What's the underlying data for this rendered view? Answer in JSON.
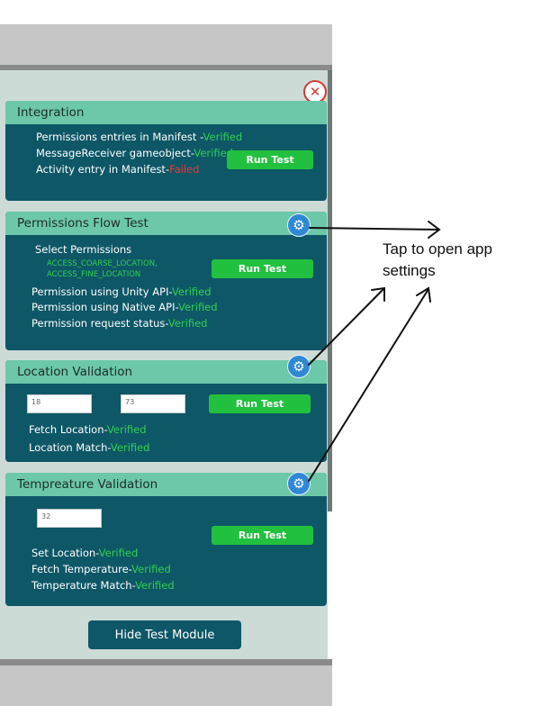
{
  "close_icon": "close-icon",
  "gear_icon": "gear-icon",
  "integration": {
    "title": "Integration",
    "lines": [
      {
        "label": "Permissions entries in Manifest -",
        "status": "Verified",
        "state": "ok"
      },
      {
        "label": "MessageReceiver gameobject-",
        "status": "Verified",
        "state": "ok"
      },
      {
        "label": "Activity entry in Manifest-",
        "status": "Failed",
        "state": "fail"
      }
    ],
    "run_label": "Run Test"
  },
  "permissions": {
    "title": "Permissions Flow Test",
    "select_label": "Select Permissions",
    "permissions_list": [
      "ACCESS_COARSE_LOCATION,",
      "ACCESS_FINE_LOCATION"
    ],
    "run_label": "Run Test",
    "lines": [
      {
        "label": "Permission using Unity API-",
        "status": "Verified"
      },
      {
        "label": "Permission using Native API-",
        "status": "Verified"
      },
      {
        "label": "Permission request status-",
        "status": "Verified"
      }
    ]
  },
  "location": {
    "title": "Location Validation",
    "input_1": "18",
    "input_2": "73",
    "run_label": "Run Test",
    "lines": [
      {
        "label": "Fetch Location-",
        "status": "Verified"
      },
      {
        "label": "Location Match-",
        "status": "Verified"
      }
    ]
  },
  "temperature": {
    "title": "Tempreature Validation",
    "input": "32",
    "run_label": "Run Test",
    "lines": [
      {
        "label": "Set Location-",
        "status": "Verified"
      },
      {
        "label": "Fetch Temperature-",
        "status": "Verified"
      },
      {
        "label": "Temperature Match-",
        "status": "Verified"
      }
    ]
  },
  "hide_button_label": "Hide Test Module",
  "annotation": {
    "line1": "Tap to open app",
    "line2": "settings"
  },
  "colors": {
    "card_bg": "#0e5767",
    "header_bg": "#6cc8a8",
    "verified": "#31d14f",
    "failed": "#e63b3b",
    "run_button": "#22c03f",
    "gear": "#2f88d3"
  }
}
